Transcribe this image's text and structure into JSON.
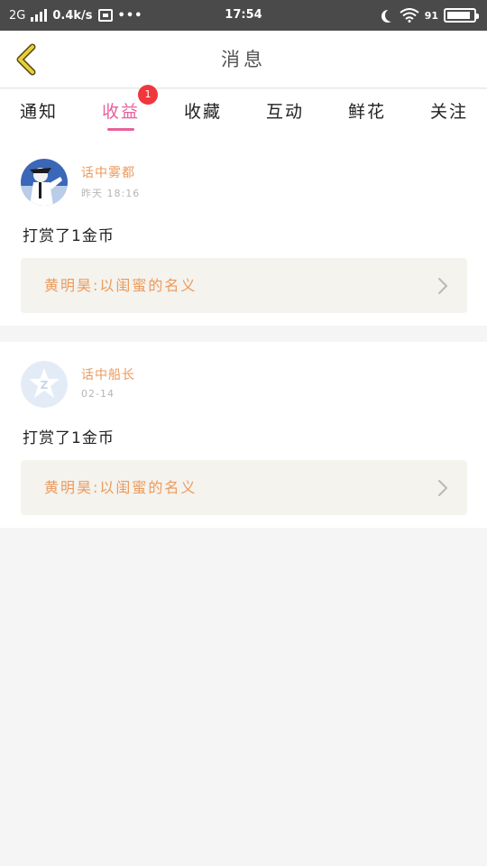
{
  "statusbar": {
    "network": "2G",
    "speed": "0.4k/s",
    "more": "•••",
    "time": "17:54",
    "battery_text": "91",
    "battery_level": 0.91
  },
  "header": {
    "title": "消息"
  },
  "tabs": [
    {
      "label": "通知",
      "active": false
    },
    {
      "label": "收益",
      "active": true,
      "badge": "1"
    },
    {
      "label": "收藏",
      "active": false
    },
    {
      "label": "互动",
      "active": false
    },
    {
      "label": "鲜花",
      "active": false
    },
    {
      "label": "关注",
      "active": false
    }
  ],
  "messages": [
    {
      "user": "话中雾都",
      "time": "昨天 18:16",
      "text": "打赏了1金币",
      "link": "黄明昊:以闺蜜的名义"
    },
    {
      "user": "话中船长",
      "time": "02-14",
      "text": "打赏了1金币",
      "link": "黄明昊:以闺蜜的名义"
    }
  ],
  "colors": {
    "accent": "#e8609a",
    "name": "#ec9a5c",
    "badge": "#f0373c",
    "back_arrow": "#e7cf3f"
  }
}
